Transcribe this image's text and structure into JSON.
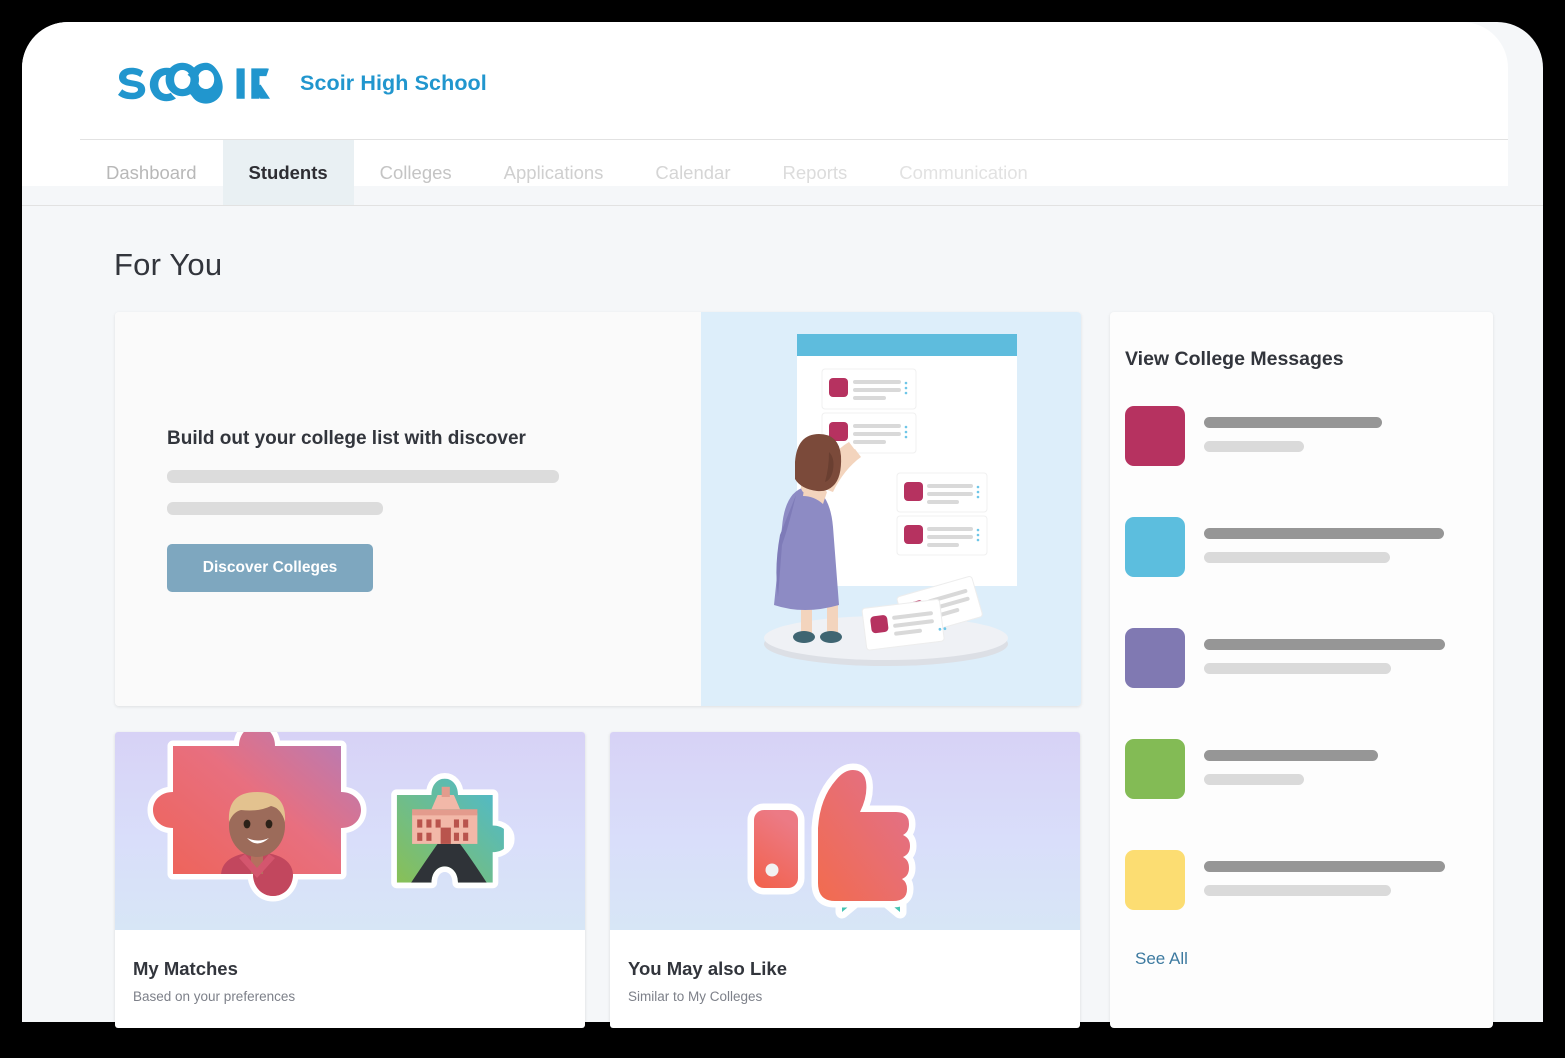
{
  "header": {
    "logo_text": "SCOIR",
    "logo_name": "scoir-logo",
    "school_name": "Scoir High School",
    "brand_color": "#2196ce"
  },
  "nav": {
    "tabs": [
      {
        "label": "Dashboard",
        "active": false
      },
      {
        "label": "Students",
        "active": true
      },
      {
        "label": "Colleges",
        "active": false
      },
      {
        "label": "Applications",
        "active": false
      },
      {
        "label": "Calendar",
        "active": false
      },
      {
        "label": "Reports",
        "active": false
      },
      {
        "label": "Communication",
        "active": false
      }
    ]
  },
  "main": {
    "page_title": "For You",
    "hero": {
      "heading": "Build out your college list with discover",
      "button_label": "Discover Colleges",
      "button_color": "#7ea7bf",
      "illustration_name": "woman-pinning-college-cards-illustration",
      "panel_bg": "#ddeefa"
    },
    "tiles": [
      {
        "title": "My Matches",
        "subtitle": "Based on your preferences",
        "illustration_name": "puzzle-pieces-person-and-campus-illustration"
      },
      {
        "title": "You May also Like",
        "subtitle": "Similar to My Colleges",
        "illustration_name": "thumbs-up-with-bookmark-illustration"
      }
    ]
  },
  "messages_panel": {
    "title": "View College Messages",
    "see_all_label": "See All",
    "see_all_color": "#3d7aa0",
    "items": [
      {
        "color": "#b63260",
        "line1_width": 178,
        "line2_width": 100
      },
      {
        "color": "#5cbede",
        "line1_width": 240,
        "line2_width": 186
      },
      {
        "color": "#8079b2",
        "line1_width": 241,
        "line2_width": 187
      },
      {
        "color": "#83bb55",
        "line1_width": 174,
        "line2_width": 100
      },
      {
        "color": "#fcdd72",
        "line1_width": 241,
        "line2_width": 187
      }
    ]
  }
}
